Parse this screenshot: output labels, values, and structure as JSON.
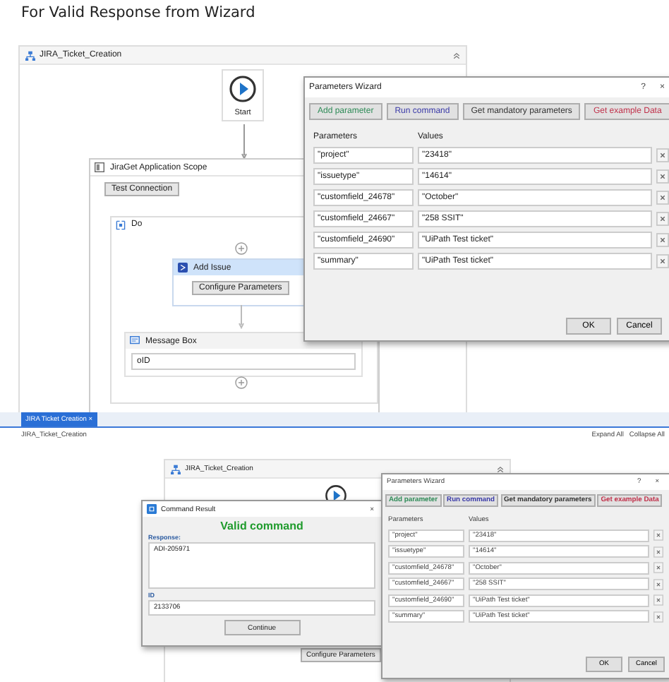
{
  "heading": "For Valid Response from Wizard",
  "top": {
    "workflow": {
      "title": "JIRA_Ticket_Creation",
      "start": "Start",
      "scope": {
        "title": "JiraGet Application Scope",
        "button": "Test Connection"
      },
      "do": {
        "title": "Do"
      },
      "add_issue": {
        "title": "Add Issue",
        "button": "Configure Parameters"
      },
      "message_box": {
        "title": "Message Box",
        "value": "oID"
      }
    },
    "wizard": {
      "title": "Parameters Wizard",
      "help": "?",
      "close": "×",
      "buttons": [
        {
          "label": "Add parameter",
          "color": "#2e8b57"
        },
        {
          "label": "Run command",
          "color": "#3a3aa8"
        },
        {
          "label": "Get mandatory parameters",
          "color": "#333333"
        },
        {
          "label": "Get example Data",
          "color": "#c0304a"
        }
      ],
      "columns": [
        "Parameters",
        "Values"
      ],
      "rows": [
        {
          "parameter": "\"project\"",
          "value": "\"23418\""
        },
        {
          "parameter": "\"issuetype\"",
          "value": "\"14614\""
        },
        {
          "parameter": "\"customfield_24678\"",
          "value": "\"October\""
        },
        {
          "parameter": "\"customfield_24667\"",
          "value": "\"258 SSIT\""
        },
        {
          "parameter": "\"customfield_24690\"",
          "value": "\"UiPath Test ticket\""
        },
        {
          "parameter": "\"summary\"",
          "value": "\"UiPath Test ticket\""
        }
      ],
      "ok": "OK",
      "cancel": "Cancel"
    }
  },
  "bottom": {
    "tab": {
      "label": "JIRA Ticket Creation",
      "close": "×"
    },
    "breadcrumb": "JIRA_Ticket_Creation",
    "expand_all": "Expand All",
    "collapse_all": "Collapse All",
    "workflow": {
      "title": "JIRA_Ticket_Creation",
      "button": "Configure Parameters"
    },
    "command_result": {
      "title": "Command Result",
      "close": "×",
      "status": "Valid command",
      "response_label": "Response:",
      "response": "ADI-205971",
      "id_label": "ID",
      "id": "2133706",
      "button": "Continue"
    },
    "wizard": {
      "title": "Parameters Wizard",
      "help": "?",
      "close": "×",
      "buttons": [
        {
          "label": "Add parameter",
          "color": "#2e8b57"
        },
        {
          "label": "Run command",
          "color": "#3a3aa8"
        },
        {
          "label": "Get mandatory parameters",
          "color": "#333333"
        },
        {
          "label": "Get example Data",
          "color": "#c0304a"
        }
      ],
      "columns": [
        "Parameters",
        "Values"
      ],
      "rows": [
        {
          "parameter": "\"project\"",
          "value": "\"23418\""
        },
        {
          "parameter": "\"issuetype\"",
          "value": "\"14614\""
        },
        {
          "parameter": "\"customfield_24678\"",
          "value": "\"October\""
        },
        {
          "parameter": "\"customfield_24667\"",
          "value": "\"258 SSIT\""
        },
        {
          "parameter": "\"customfield_24690\"",
          "value": "\"UiPath Test ticket\""
        },
        {
          "parameter": "\"summary\"",
          "value": "\"UiPath Test ticket\""
        }
      ],
      "ok": "OK",
      "cancel": "Cancel"
    }
  }
}
